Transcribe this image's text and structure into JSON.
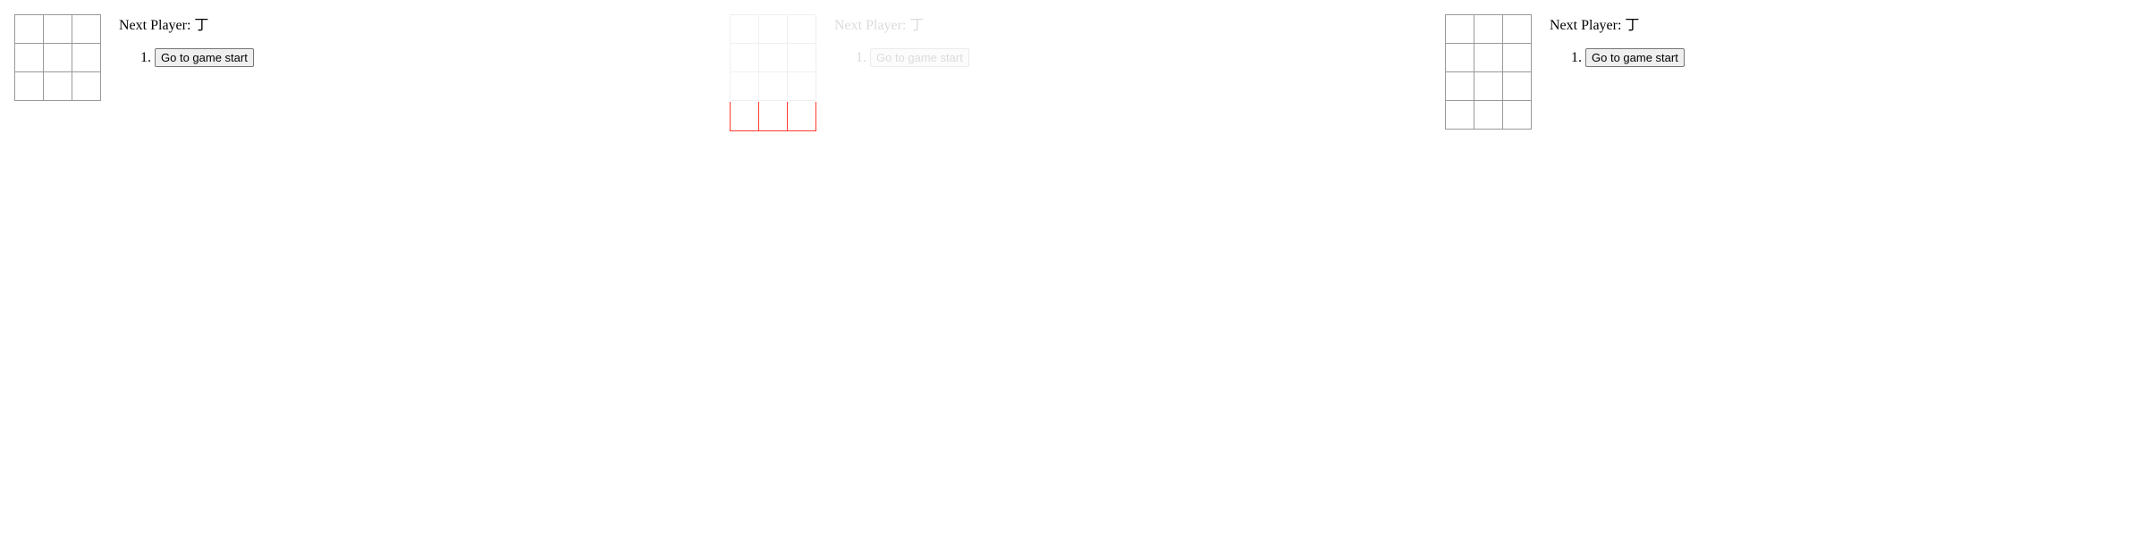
{
  "frames": [
    {
      "status_label": "Next Player:",
      "next_player": "丁",
      "moves": [
        {
          "number": "1.",
          "label": "Go to game start"
        }
      ],
      "board_rows": 3,
      "board_cols": 3,
      "squares": [
        "",
        "",
        "",
        "",
        "",
        "",
        "",
        "",
        ""
      ]
    },
    {
      "status_label": "Next Player:",
      "next_player": "丁",
      "moves": [
        {
          "number": "1.",
          "label": "Go to game start"
        }
      ],
      "board_rows": 3,
      "board_cols": 3,
      "squares": [
        "",
        "",
        "",
        "",
        "",
        "",
        "",
        "",
        ""
      ],
      "ghost_row_color": "#ff3b30",
      "faded": true
    },
    {
      "status_label": "Next Player:",
      "next_player": "丁",
      "moves": [
        {
          "number": "1.",
          "label": "Go to game start"
        }
      ],
      "board_rows": 4,
      "board_cols": 3,
      "squares": [
        "",
        "",
        "",
        "",
        "",
        "",
        "",
        "",
        "",
        "",
        "",
        ""
      ]
    }
  ]
}
